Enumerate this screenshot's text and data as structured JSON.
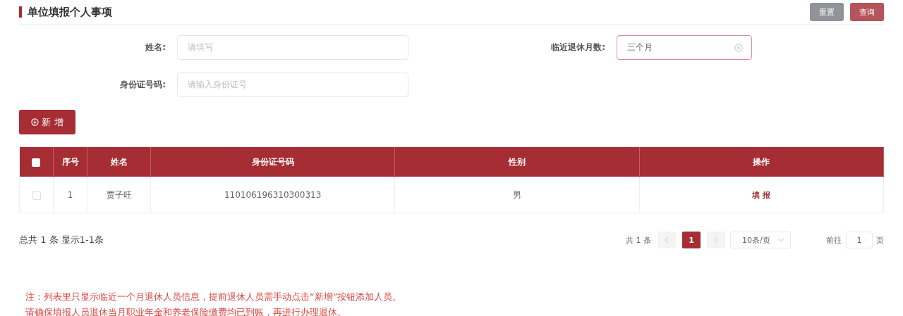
{
  "title": "单位填报个人事项",
  "header_buttons": [
    {
      "label": "重置",
      "kind": "reset"
    },
    {
      "label": "查询",
      "kind": "primary"
    }
  ],
  "form": {
    "fields": [
      {
        "label": "姓名:",
        "placeholder": "请填写",
        "focused": false
      },
      {
        "label": "临近退休月数:",
        "value": "三个月",
        "focused": true,
        "clearable": true
      },
      {
        "label": "身份证号码:",
        "placeholder": "请输入身份证号",
        "focused": false
      }
    ]
  },
  "add_button": {
    "label": "新 增"
  },
  "table": {
    "select_all": {
      "checked": false
    },
    "columns": [
      "序号",
      "姓名",
      "身份证号码",
      "性别",
      "操作"
    ],
    "rows": [
      {
        "checked": false,
        "cells": [
          "1",
          "贾子旺",
          "110106196310300313",
          "男"
        ],
        "action": "填 报"
      }
    ]
  },
  "summary": "总共 1 条 显示1-1条",
  "pagination": {
    "total": "共 1 条",
    "pages": [
      {
        "label": "1",
        "selected": true
      }
    ],
    "page_size": "10条/页",
    "goto_label": "前往",
    "goto_value": "1",
    "goto_suffix": "页"
  },
  "notes": [
    "注：列表里只显示临近一个月退休人员信息，提前退休人员需手动点击“新增”按钮添加人员。",
    "请确保填报人员退休当月职业年金和养老保险缴费均已到账，再进行办理退休。"
  ]
}
